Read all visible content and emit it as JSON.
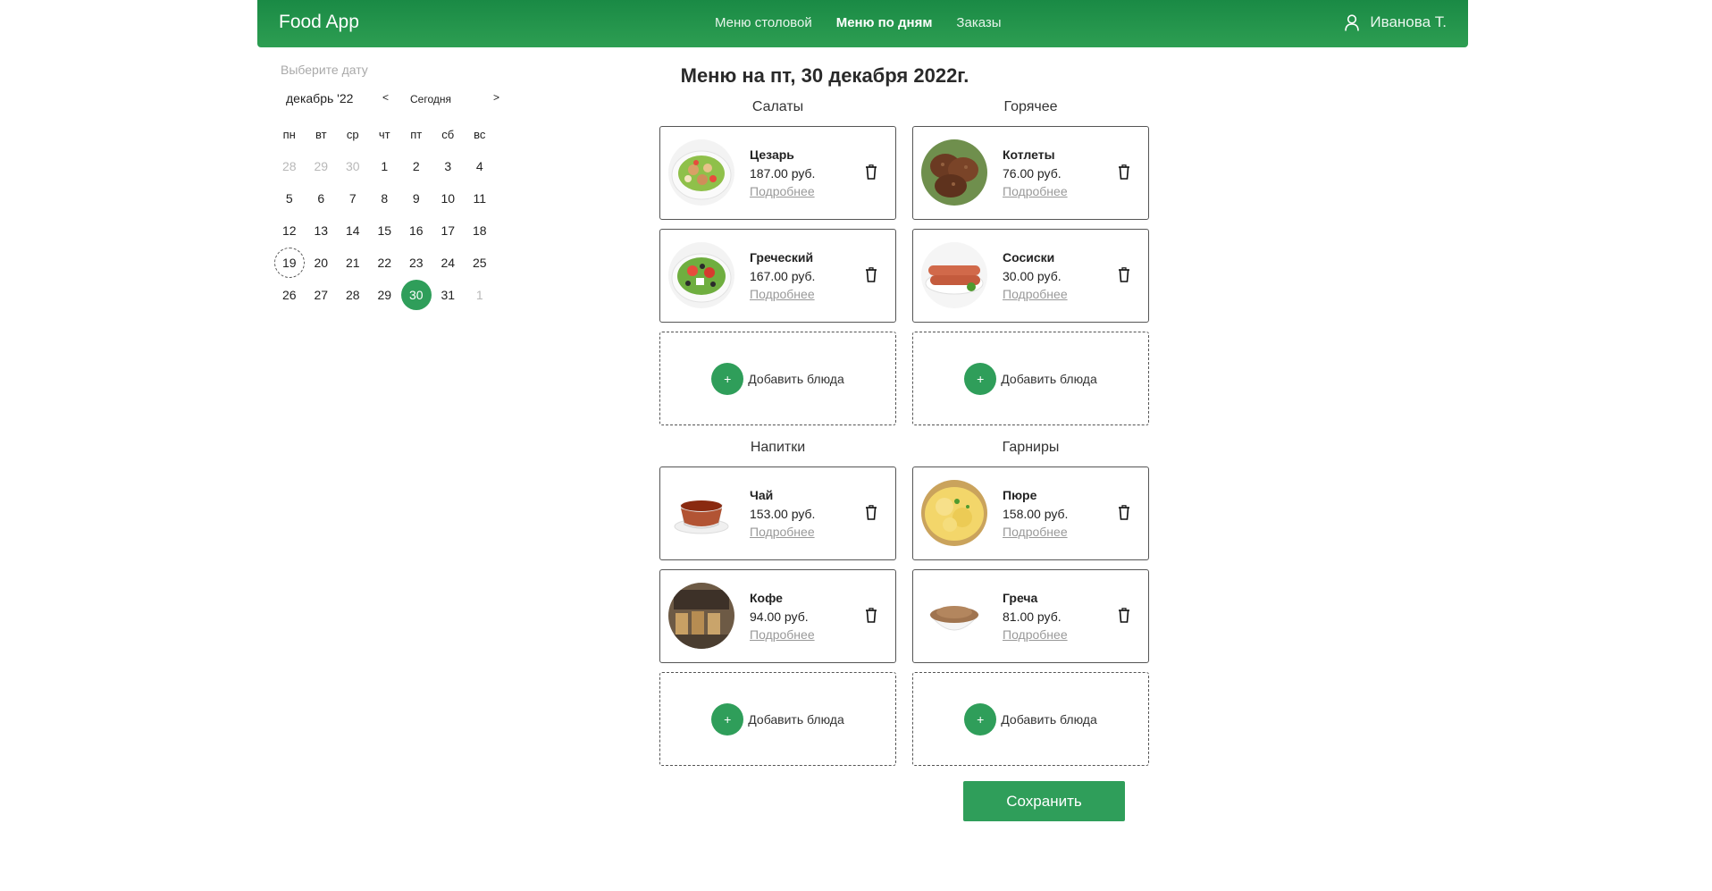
{
  "header": {
    "brand": "Food App",
    "nav": [
      {
        "label": "Меню столовой",
        "active": false
      },
      {
        "label": "Меню по дням",
        "active": true
      },
      {
        "label": "Заказы",
        "active": false
      }
    ],
    "user_name": "Иванова Т."
  },
  "calendar": {
    "hint": "Выберите дату",
    "month_label": "декабрь '22",
    "prev_label": "<",
    "today_label": "Сегодня",
    "next_label": ">",
    "weekdays": [
      "пн",
      "вт",
      "ср",
      "чт",
      "пт",
      "сб",
      "вс"
    ],
    "days": [
      {
        "d": "28",
        "muted": true
      },
      {
        "d": "29",
        "muted": true
      },
      {
        "d": "30",
        "muted": true
      },
      {
        "d": "1"
      },
      {
        "d": "2"
      },
      {
        "d": "3"
      },
      {
        "d": "4"
      },
      {
        "d": "5"
      },
      {
        "d": "6"
      },
      {
        "d": "7"
      },
      {
        "d": "8"
      },
      {
        "d": "9"
      },
      {
        "d": "10"
      },
      {
        "d": "11"
      },
      {
        "d": "12"
      },
      {
        "d": "13"
      },
      {
        "d": "14"
      },
      {
        "d": "15"
      },
      {
        "d": "16"
      },
      {
        "d": "17"
      },
      {
        "d": "18"
      },
      {
        "d": "19",
        "today": true
      },
      {
        "d": "20"
      },
      {
        "d": "21"
      },
      {
        "d": "22"
      },
      {
        "d": "23"
      },
      {
        "d": "24"
      },
      {
        "d": "25"
      },
      {
        "d": "26"
      },
      {
        "d": "27"
      },
      {
        "d": "28"
      },
      {
        "d": "29"
      },
      {
        "d": "30",
        "selected": true
      },
      {
        "d": "31"
      },
      {
        "d": "1",
        "muted": true
      }
    ]
  },
  "main": {
    "title": "Меню на пт, 30 декабря 2022г.",
    "more_label": "Подробнее",
    "add_label": "Добавить блюда",
    "add_symbol": "+",
    "categories": [
      {
        "name": "Салаты",
        "dishes": [
          {
            "name": "Цезарь",
            "price": "187.00 руб.",
            "image": "caesar-salad"
          },
          {
            "name": "Греческий",
            "price": "167.00 руб.",
            "image": "greek-salad"
          }
        ]
      },
      {
        "name": "Горячее",
        "dishes": [
          {
            "name": "Котлеты",
            "price": "76.00 руб.",
            "image": "cutlets"
          },
          {
            "name": "Сосиски",
            "price": "30.00 руб.",
            "image": "sausages"
          }
        ]
      },
      {
        "name": "Напитки",
        "dishes": [
          {
            "name": "Чай",
            "price": "153.00 руб.",
            "image": "tea"
          },
          {
            "name": "Кофе",
            "price": "94.00 руб.",
            "image": "coffee"
          }
        ]
      },
      {
        "name": "Гарниры",
        "dishes": [
          {
            "name": "Пюре",
            "price": "158.00 руб.",
            "image": "mashed-potatoes"
          },
          {
            "name": "Греча",
            "price": "81.00 руб.",
            "image": "buckwheat"
          }
        ]
      }
    ],
    "save_label": "Сохранить"
  },
  "colors": {
    "accent": "#2f9e5a",
    "header_top": "#1a8a45",
    "header_bottom": "#2d9e52"
  }
}
